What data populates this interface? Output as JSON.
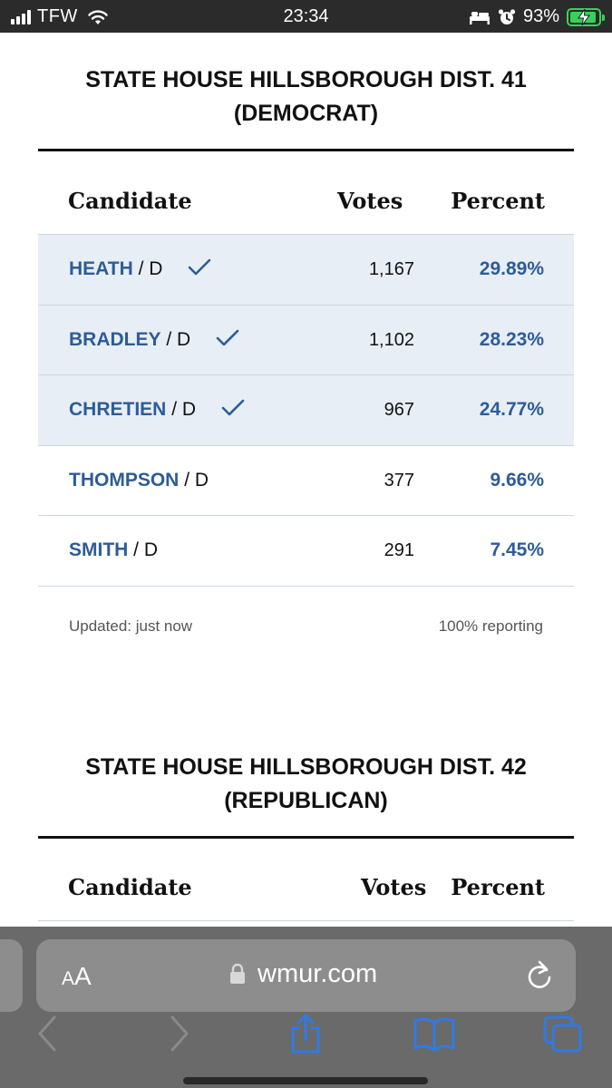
{
  "status_bar": {
    "carrier": "TFW",
    "time": "23:34",
    "battery_percent": "93%",
    "battery_level": 0.93,
    "icons": [
      "signal-icon",
      "wifi-icon",
      "bed-icon",
      "alarm-icon",
      "battery-charging-icon"
    ]
  },
  "races": [
    {
      "title": "STATE HOUSE HILLSBOROUGH DIST. 41\n(DEMOCRAT)",
      "headers": {
        "candidate": "Candidate",
        "votes": "Votes",
        "percent": "Percent"
      },
      "rows": [
        {
          "name": "HEATH",
          "party": "/ D",
          "votes": "1,167",
          "percent": "29.89%",
          "winner": true
        },
        {
          "name": "BRADLEY",
          "party": "/ D",
          "votes": "1,102",
          "percent": "28.23%",
          "winner": true
        },
        {
          "name": "CHRETIEN",
          "party": "/ D",
          "votes": "967",
          "percent": "24.77%",
          "winner": true
        },
        {
          "name": "THOMPSON",
          "party": "/ D",
          "votes": "377",
          "percent": "9.66%",
          "winner": false
        },
        {
          "name": "SMITH",
          "party": "/ D",
          "votes": "291",
          "percent": "7.45%",
          "winner": false
        }
      ],
      "updated": "Updated: just now",
      "reporting": "100% reporting"
    },
    {
      "title": "STATE HOUSE HILLSBOROUGH DIST. 42\n(REPUBLICAN)",
      "headers": {
        "candidate": "Candidate",
        "votes": "Votes",
        "percent": "Percent"
      }
    }
  ],
  "browser": {
    "text_size_label": "AA",
    "url": "wmur.com",
    "toolbar_icons": [
      "back-icon",
      "forward-icon",
      "share-icon",
      "bookmarks-icon",
      "tabs-icon"
    ]
  },
  "colors": {
    "accent_blue": "#2d5c98",
    "winner_row_bg": "#e8eef6",
    "battery_green": "#35d35d"
  }
}
